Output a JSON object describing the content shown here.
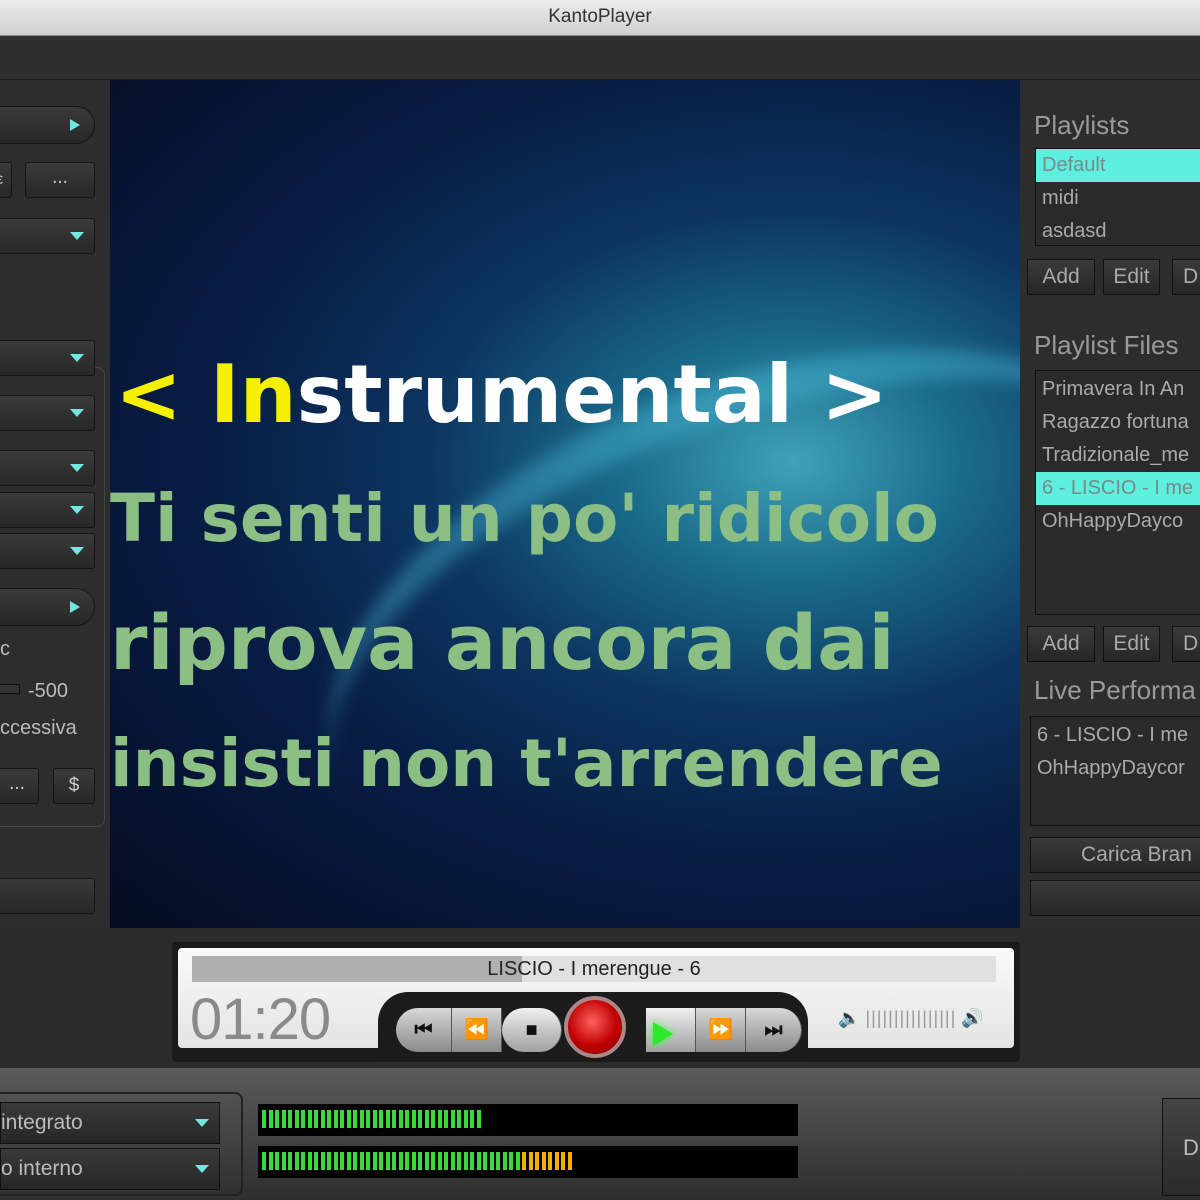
{
  "window": {
    "title": "KantoPlayer"
  },
  "left_panel": {
    "partial_label_1": "c",
    "slider_value": "-500",
    "partial_label_2": "ccessiva",
    "more_button": "...",
    "dollar_button": "$",
    "partial_button": "ε",
    "more_button_top": "..."
  },
  "lyrics": {
    "line1_sung": "< In",
    "line1_rest": "strumental >",
    "line2": "Ti senti un po' ridicolo",
    "line3": "riprova ancora dai",
    "line4": "insisti non t'arrendere"
  },
  "playlists": {
    "title": "Playlists",
    "items": [
      {
        "label": "Default",
        "selected": true
      },
      {
        "label": "midi"
      },
      {
        "label": "asdasd"
      }
    ],
    "add": "Add",
    "edit": "Edit",
    "delete": "D"
  },
  "playlist_files": {
    "title": "Playlist Files",
    "items": [
      {
        "label": "Primavera In An"
      },
      {
        "label": "Ragazzo fortuna"
      },
      {
        "label": "Tradizionale_me"
      },
      {
        "label": "6 - LISCIO - I me",
        "selected": true
      },
      {
        "label": "OhHappyDayco"
      }
    ],
    "add": "Add",
    "edit": "Edit",
    "delete": "D"
  },
  "live": {
    "title": "Live Performa",
    "items": [
      {
        "label": "6 - LISCIO - I me"
      },
      {
        "label": "OhHappyDaycor"
      }
    ],
    "load_button": "Carica Bran"
  },
  "transport": {
    "song": "LISCIO - I merengue - 6",
    "time": "01:20",
    "progress_percent": 41,
    "accent": "#5df0e0"
  },
  "bottom": {
    "output1": "integrato",
    "output2": "o interno",
    "meter_top_percent": 41,
    "meter_bottom_percent": 59,
    "d_button": "D"
  }
}
